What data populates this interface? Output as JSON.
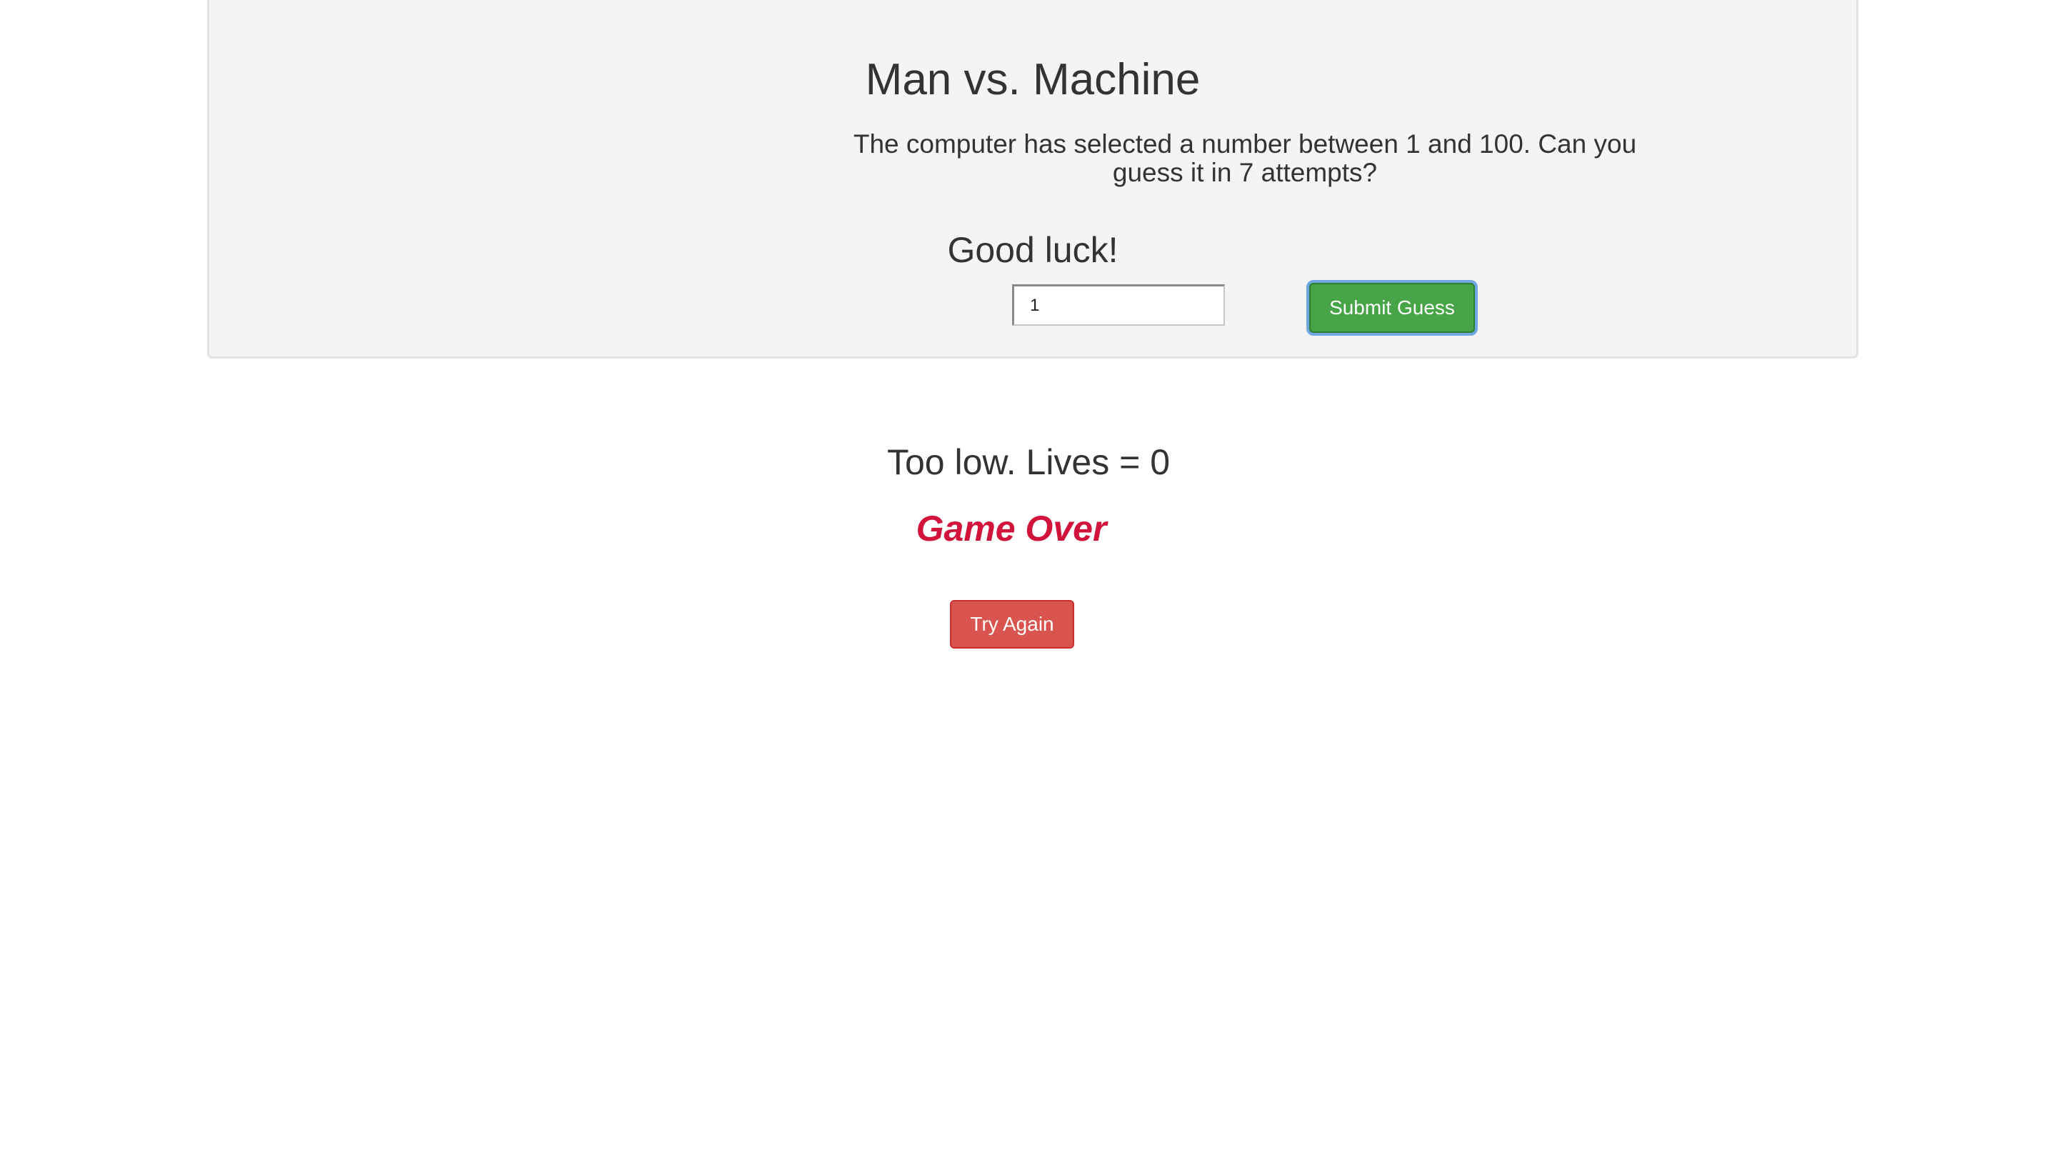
{
  "window": {
    "title": "Man vs. Machine"
  },
  "header": {
    "title": "Man vs. Machine",
    "description": "The computer has selected a number between 1 and 100. Can you guess it in 7 attempts?",
    "encouragement": "Good luck!"
  },
  "guess_form": {
    "input_value": "1",
    "submit_label": "Submit Guess"
  },
  "result": {
    "message": "Too low. Lives = 0",
    "status": "Game Over",
    "retry_label": "Try Again"
  },
  "colors": {
    "panel_background": "#f4f4f4",
    "submit_button": "#47a447",
    "focus_ring": "#6fa7e3",
    "game_over_text": "#d2143c",
    "retry_button": "#d9534f",
    "text": "#333333"
  }
}
